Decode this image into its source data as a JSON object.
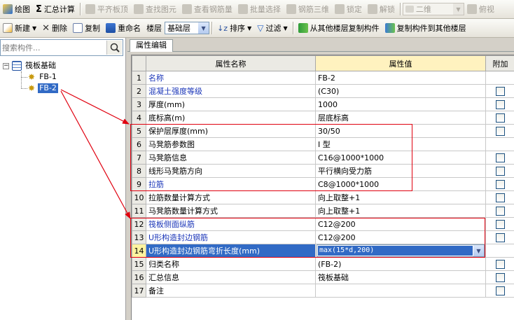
{
  "toolbar1": {
    "items": [
      {
        "label": "绘图",
        "icon": "pencil-icon",
        "enabled": true
      },
      {
        "label": "汇总计算",
        "icon": "sigma-icon",
        "enabled": true
      },
      {
        "label": "平齐板顶",
        "icon": "align-top-icon",
        "enabled": false
      },
      {
        "label": "查找图元",
        "icon": "find-icon",
        "enabled": false
      },
      {
        "label": "查看钢筋量",
        "icon": "view-rebar-icon",
        "enabled": false
      },
      {
        "label": "批量选择",
        "icon": "batch-select-icon",
        "enabled": false
      },
      {
        "label": "钢筋三维",
        "icon": "rebar-3d-icon",
        "enabled": false
      },
      {
        "label": "锁定",
        "icon": "lock-icon",
        "enabled": false
      },
      {
        "label": "解锁",
        "icon": "unlock-icon",
        "enabled": false
      }
    ],
    "view_select": "二维",
    "overhead_label": "俯视"
  },
  "toolbar2": {
    "new_label": "新建",
    "delete_label": "删除",
    "copy_label": "复制",
    "rename_label": "重命名",
    "floor_label": "楼层",
    "floor_value": "基础层",
    "sort_label": "排序",
    "filter_label": "过滤",
    "copy_from_label": "从其他楼层复制构件",
    "copy_to_label": "复制构件到其他楼层"
  },
  "search": {
    "placeholder": "搜索构件..."
  },
  "tree": {
    "root": "筏板基础",
    "children": [
      "FB-1",
      "FB-2"
    ],
    "selected": "FB-2"
  },
  "tab": {
    "label": "属性编辑"
  },
  "table": {
    "headers": {
      "name": "属性名称",
      "value": "属性值",
      "extra": "附加"
    },
    "rows": [
      {
        "num": "1",
        "name": "名称",
        "value": "FB-2",
        "blue": true,
        "check": false
      },
      {
        "num": "2",
        "name": "混凝土强度等级",
        "value": "(C30)",
        "blue": true,
        "check": true
      },
      {
        "num": "3",
        "name": "厚度(mm)",
        "value": "1000",
        "blue": false,
        "check": true
      },
      {
        "num": "4",
        "name": "底标高(m)",
        "value": "层底标高",
        "blue": false,
        "check": true
      },
      {
        "num": "5",
        "name": "保护层厚度(mm)",
        "value": "30/50",
        "blue": false,
        "check": true
      },
      {
        "num": "6",
        "name": "马凳筋参数图",
        "value": "I 型",
        "blue": false,
        "check": false
      },
      {
        "num": "7",
        "name": "马凳筋信息",
        "value": "C16@1000*1000",
        "blue": false,
        "check": true
      },
      {
        "num": "8",
        "name": "线形马凳筋方向",
        "value": "平行横向受力筋",
        "blue": false,
        "check": true
      },
      {
        "num": "9",
        "name": "拉筋",
        "value": "C8@1000*1000",
        "blue": true,
        "check": true
      },
      {
        "num": "10",
        "name": "拉筋数量计算方式",
        "value": "向上取整+1",
        "blue": false,
        "check": true
      },
      {
        "num": "11",
        "name": "马凳筋数量计算方式",
        "value": "向上取整+1",
        "blue": false,
        "check": true
      },
      {
        "num": "12",
        "name": "筏板侧面纵筋",
        "value": "C12@200",
        "blue": true,
        "check": true
      },
      {
        "num": "13",
        "name": "U形构造封边钢筋",
        "value": "C12@200",
        "blue": true,
        "check": true
      },
      {
        "num": "14",
        "name": "U形构造封边钢筋弯折长度(mm)",
        "value": "max(15*d,200)",
        "blue": true,
        "check": false,
        "selected": true
      },
      {
        "num": "15",
        "name": "归类名称",
        "value": "(FB-2)",
        "blue": false,
        "check": true
      },
      {
        "num": "16",
        "name": "汇总信息",
        "value": "筏板基础",
        "blue": false,
        "check": true
      },
      {
        "num": "17",
        "name": "备注",
        "value": "",
        "blue": false,
        "check": true
      }
    ]
  },
  "colors": {
    "selection": "#316ac5",
    "annotation": "#e0000f",
    "header_value": "#fff2bf",
    "blue_text": "#1a35b8"
  }
}
